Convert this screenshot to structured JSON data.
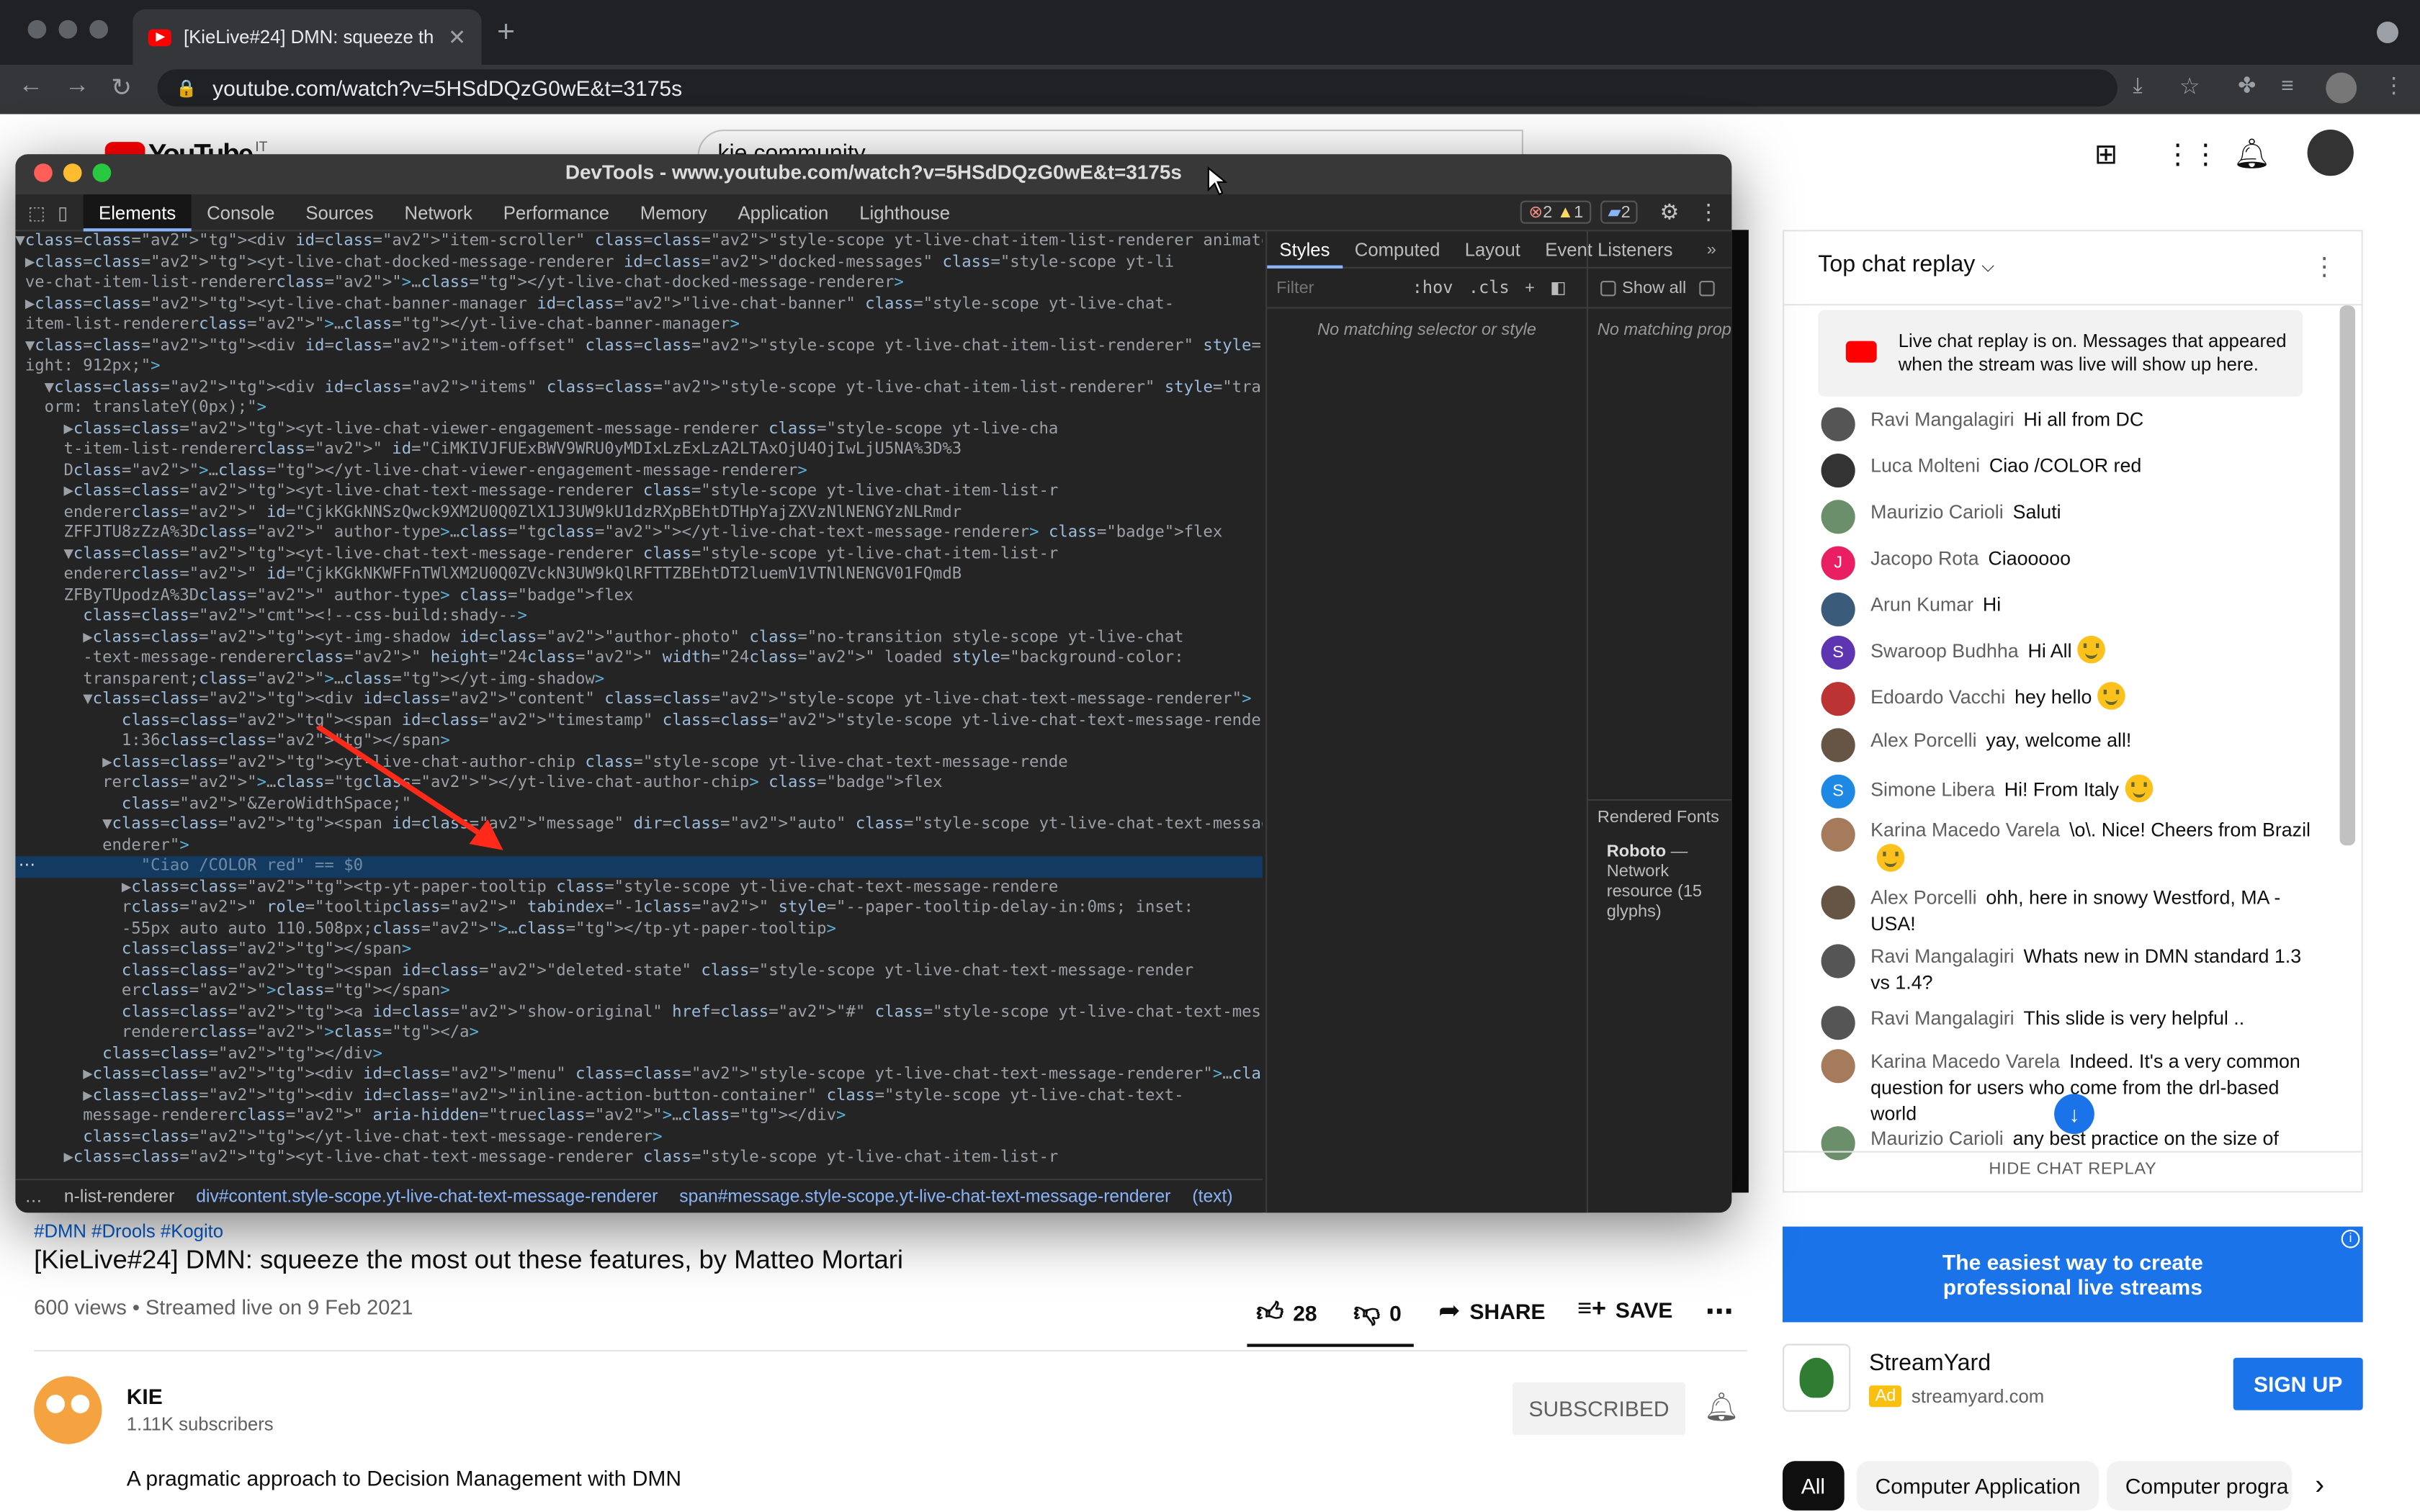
{
  "browser": {
    "tab_title": "[KieLive#24] DMN: squeeze th",
    "url": "youtube.com/watch?v=5HSdDQzG0wE&t=3175s"
  },
  "youtube": {
    "logo": "YouTube",
    "country": "IT",
    "search_value": "kie community"
  },
  "devtools": {
    "title": "DevTools - www.youtube.com/watch?v=5HSdDQzG0wE&t=3175s",
    "tabs": [
      "Elements",
      "Console",
      "Sources",
      "Network",
      "Performance",
      "Memory",
      "Application",
      "Lighthouse"
    ],
    "errors": "2",
    "warnings": "1",
    "messages": "2",
    "styles_tabs": [
      "Styles",
      "Computed",
      "Layout",
      "Event Listeners"
    ],
    "filter_placeholder": "Filter",
    "hov": ":hov",
    "cls": ".cls",
    "no_match": "No matching selector or style",
    "show_all": "Show all",
    "no_match2": "No matching prop",
    "rendered_fonts": "Rendered Fonts",
    "font_name": "Roboto",
    "font_rest": "— Network resource (15 glyphs)",
    "crumbs": [
      "n-list-renderer",
      "div#content.style-scope.yt-live-chat-text-message-renderer",
      "span#message.style-scope.yt-live-chat-text-message-renderer",
      "(text)"
    ],
    "code_lines": [
      "▼<div id=\"item-scroller\" class=\"style-scope yt-live-chat-item-list-renderer animated\">",
      " ▶<yt-live-chat-docked-message-renderer id=\"docked-messages\" class=\"style-scope yt-li",
      " ve-chat-item-list-renderer\">…</yt-live-chat-docked-message-renderer>",
      " ▶<yt-live-chat-banner-manager id=\"live-chat-banner\" class=\"style-scope yt-live-chat-",
      " item-list-renderer\">…</yt-live-chat-banner-manager>",
      " ▼<div id=\"item-offset\" class=\"style-scope yt-live-chat-item-list-renderer\" style=\"he",
      " ight: 912px;\">",
      "   ▼<div id=\"items\" class=\"style-scope yt-live-chat-item-list-renderer\" style=\"transf",
      "   orm: translateY(0px);\">",
      "     ▶<yt-live-chat-viewer-engagement-message-renderer class=\"style-scope yt-live-cha",
      "     t-item-list-renderer\" id=\"CiMKIVJFUExBWV9WRU0yMDIxLzExLzA2LTAxOjU4OjIwLjU5NA%3D%3",
      "     D\">…</yt-live-chat-viewer-engagement-message-renderer>",
      "     ▶<yt-live-chat-text-message-renderer class=\"style-scope yt-live-chat-item-list-r",
      "     enderer\" id=\"CjkKGkNNSzQwck9XM2U0Q0ZlX1J3UW9kU1dzRXpBEhtDTHpYajZXVzNlNENGYzNLRmdr",
      "     ZFFJTU8zZzA%3D\" author-type>…</yt-live-chat-text-message-renderer> [flex]",
      "     ▼<yt-live-chat-text-message-renderer class=\"style-scope yt-live-chat-item-list-r",
      "     enderer\" id=\"CjkKGkNKWFFnTWlXM2U0Q0ZVckN3UW9kQlRFTTZBEhtDT2luemV1VTNlNENGV01FQmdB",
      "     ZFByTUpodzA%3D\" author-type> [flex]",
      "       <!--css-build:shady-->",
      "       ▶<yt-img-shadow id=\"author-photo\" class=\"no-transition style-scope yt-live-chat",
      "       -text-message-renderer\" height=\"24\" width=\"24\" loaded style=\"background-color:",
      "       transparent;\">…</yt-img-shadow>",
      "       ▼<div id=\"content\" class=\"style-scope yt-live-chat-text-message-renderer\">",
      "           <span id=\"timestamp\" class=\"style-scope yt-live-chat-text-message-renderer\">",
      "           1:36</span>",
      "         ▶<yt-live-chat-author-chip class=\"style-scope yt-live-chat-text-message-rende",
      "         rer\">…</yt-live-chat-author-chip> [flex]",
      "           \"&ZeroWidthSpace;\"",
      "         ▼<span id=\"message\" dir=\"auto\" class=\"style-scope yt-live-chat-text-message-r",
      "         enderer\">",
      "             \"Ciao /COLOR red\" == $0",
      "           ▶<tp-yt-paper-tooltip class=\"style-scope yt-live-chat-text-message-rendere",
      "           r\" role=\"tooltip\" tabindex=\"-1\" style=\"--paper-tooltip-delay-in:0ms; inset:",
      "           -55px auto auto 110.508px;\">…</tp-yt-paper-tooltip>",
      "           </span>",
      "           <span id=\"deleted-state\" class=\"style-scope yt-live-chat-text-message-render",
      "           er\"></span>",
      "           <a id=\"show-original\" href=\"#\" class=\"style-scope yt-live-chat-text-message-",
      "           renderer\"></a>",
      "         </div>",
      "       ▶<div id=\"menu\" class=\"style-scope yt-live-chat-text-message-renderer\">…</div>",
      "       ▶<div id=\"inline-action-button-container\" class=\"style-scope yt-live-chat-text-",
      "       message-renderer\" aria-hidden=\"true\">…</div>",
      "       </yt-live-chat-text-message-renderer>",
      "     ▶<yt-live-chat-text-message-renderer class=\"style-scope yt-live-chat-item-list-r"
    ]
  },
  "chat": {
    "header": "Top chat replay",
    "notice": "Live chat replay is on. Messages that appeared when the stream was live will show up here.",
    "hide": "HIDE CHAT REPLAY",
    "messages": [
      {
        "author": "Ravi Mangalagiri",
        "text": "Hi all from DC",
        "color": "#555"
      },
      {
        "author": "Luca Molteni",
        "text": "Ciao /COLOR red",
        "color": "#333"
      },
      {
        "author": "Maurizio Carioli",
        "text": "Saluti",
        "color": "#6a8f6a"
      },
      {
        "author": "Jacopo Rota",
        "text": "Ciaooooo",
        "color": "#e91e63",
        "initial": "J"
      },
      {
        "author": "Arun Kumar",
        "text": "Hi",
        "color": "#3b5b7a"
      },
      {
        "author": "Swaroop Budhha",
        "text": "Hi All",
        "color": "#5e35b1",
        "initial": "S",
        "emoji": true
      },
      {
        "author": "Edoardo Vacchi",
        "text": "hey hello",
        "color": "#b33",
        "emoji": true
      },
      {
        "author": "Alex Porcelli",
        "text": "yay, welcome all!",
        "color": "#654"
      },
      {
        "author": "Simone Libera",
        "text": "Hi! From Italy",
        "color": "#1e88e5",
        "initial": "S",
        "emoji": true
      },
      {
        "author": "Karina Macedo Varela",
        "text": "\\o\\. Nice! Cheers from Brazil",
        "color": "#a67b5b",
        "emoji": true
      },
      {
        "author": "Alex Porcelli",
        "text": "ohh, here in snowy Westford, MA - USA!",
        "color": "#654"
      },
      {
        "author": "Ravi Mangalagiri",
        "text": "Whats new in DMN standard 1.3 vs 1.4?",
        "color": "#555"
      },
      {
        "author": "Ravi Mangalagiri",
        "text": "This slide is very helpful ..",
        "color": "#555"
      },
      {
        "author": "Karina Macedo Varela",
        "text": "Indeed. It's a very common question for users who come from the drl-based world",
        "color": "#a67b5b"
      },
      {
        "author": "Maurizio Carioli",
        "text": "any best practice on the size of",
        "color": "#6a8f6a"
      }
    ]
  },
  "ad": {
    "line1": "The easiest way to create",
    "line2": "professional live streams",
    "name": "StreamYard",
    "badge": "Ad",
    "domain": "streamyard.com",
    "cta": "SIGN UP"
  },
  "video": {
    "tags": "#DMN #Drools #Kogito",
    "title": "[KieLive#24] DMN: squeeze the most out these features, by Matteo Mortari",
    "meta": "600 views • Streamed live on 9 Feb 2021",
    "likes": "28",
    "dislikes": "0",
    "share": "SHARE",
    "save": "SAVE",
    "channel": "KIE",
    "subs": "1.11K subscribers",
    "subscribed": "SUBSCRIBED",
    "description": "A pragmatic approach to Decision Management with DMN"
  },
  "chips": [
    "All",
    "Computer Application",
    "Computer progra"
  ],
  "colors": {
    "yt_red": "#ff0000",
    "devtools_bg": "#242424",
    "link_blue": "#065fd4",
    "ad_blue": "#1a73e8"
  }
}
